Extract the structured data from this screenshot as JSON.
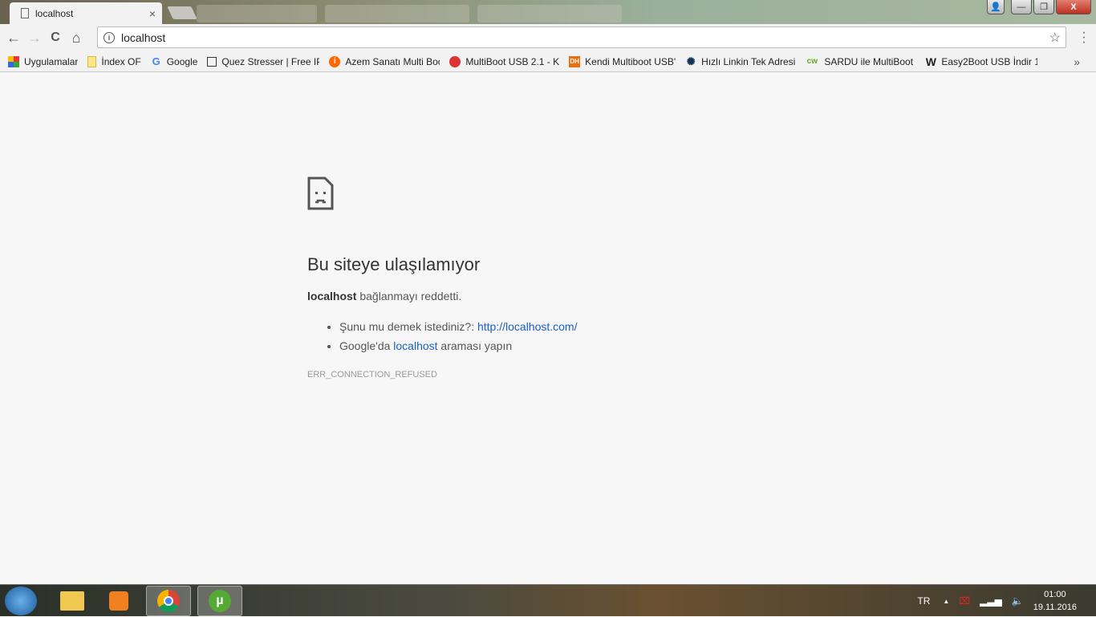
{
  "tab": {
    "title": "localhost",
    "close": "×"
  },
  "window": {
    "minimize": "—",
    "restore": "❐",
    "close": "X",
    "user": "👤"
  },
  "toolbar": {
    "back": "←",
    "forward": "→",
    "reload": "C",
    "home": "⌂",
    "url": "localhost",
    "star": "☆",
    "menu": "⋮"
  },
  "bookmarks": [
    {
      "label": "Uygulamalar",
      "icon": "apps-grid-icon"
    },
    {
      "label": "İndex OF",
      "icon": "folder-icon"
    },
    {
      "label": "Google",
      "icon": "google-icon"
    },
    {
      "label": "Quez Stresser | Free IP",
      "icon": "search-page-icon"
    },
    {
      "label": "Azem Sanatı Multi Boot",
      "icon": "orange-circle-icon"
    },
    {
      "label": "MultiBoot USB 2.1 - K",
      "icon": "red-circle-icon"
    },
    {
      "label": "Kendi Multiboot USB'",
      "icon": "dh-icon"
    },
    {
      "label": "Hızlı Linkin Tek Adresi",
      "icon": "swirl-icon"
    },
    {
      "label": "SARDU ile MultiBoot U",
      "icon": "cw-icon"
    },
    {
      "label": "Easy2Boot USB İndir 1",
      "icon": "w-icon"
    }
  ],
  "bookmarks_more": "»",
  "error": {
    "title": "Bu siteye ulaşılamıyor",
    "host": "localhost",
    "desc": " bağlanmayı reddetti.",
    "suggest_prefix": "Şunu mu demek istediniz?: ",
    "suggest_link": "http://localhost.com/",
    "google_prefix": "Google'da ",
    "google_link": "localhost",
    "google_suffix": " araması yapın",
    "code": "ERR_CONNECTION_REFUSED"
  },
  "tray": {
    "lang": "TR",
    "time": "01:00",
    "date": "19.11.2016"
  }
}
